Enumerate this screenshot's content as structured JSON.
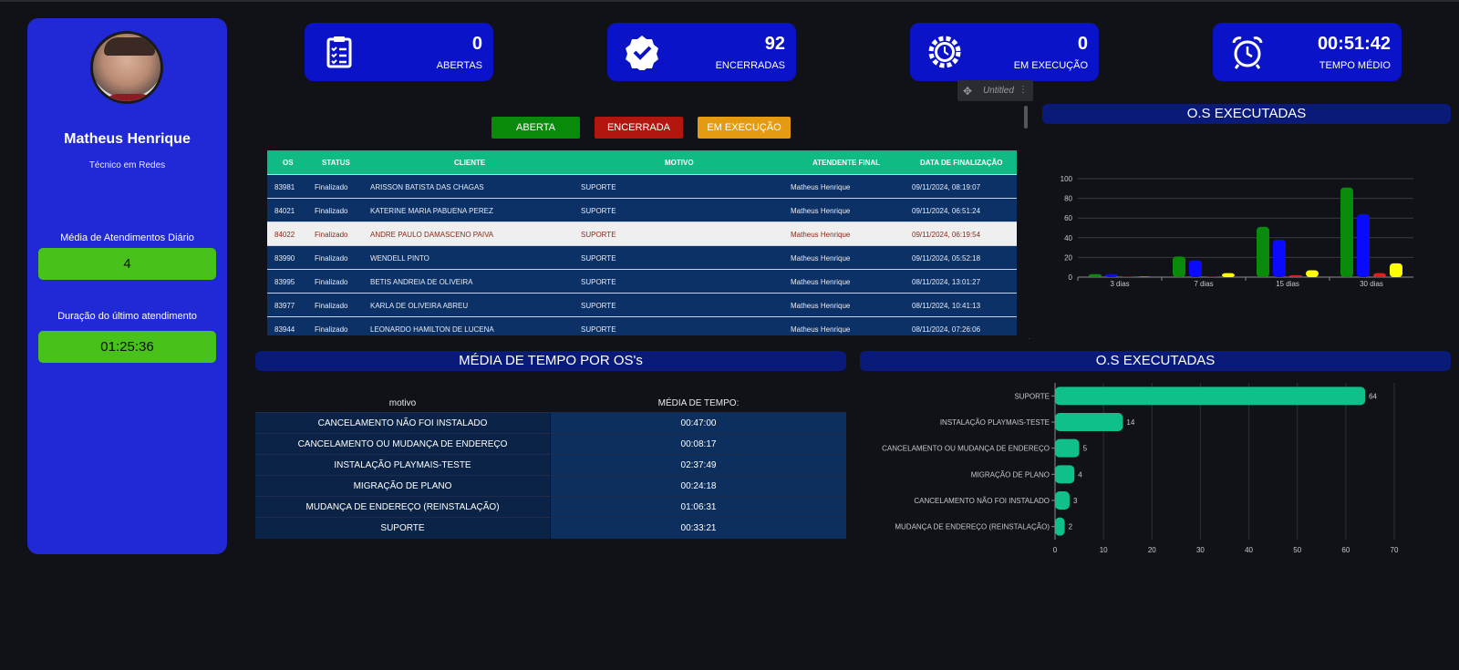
{
  "sidebar": {
    "name": "Matheus Henrique",
    "role": "Técnico em Redes",
    "daily_avg_label": "Média de Atendimentos Diário",
    "daily_avg_value": "4",
    "last_duration_label": "Duração do último atendimento",
    "last_duration_value": "01:25:36"
  },
  "kpis": [
    {
      "value": "0",
      "label": "ABERTAS",
      "icon": "clipboard-list-icon"
    },
    {
      "value": "92",
      "label": "ENCERRADAS",
      "icon": "badge-check-icon"
    },
    {
      "value": "0",
      "label": "EM EXECUÇÃO",
      "icon": "gear-clock-icon"
    },
    {
      "value": "00:51:42",
      "label": "TEMPO MÉDIO",
      "icon": "alarm-clock-icon"
    }
  ],
  "panel_tag": {
    "name": "Untitled",
    "move_icon": "move-icon",
    "menu_icon": "more-vertical-icon"
  },
  "filters": [
    {
      "label": "ABERTA",
      "color": "#0a8a0a"
    },
    {
      "label": "ENCERRADA",
      "color": "#b3160e"
    },
    {
      "label": "EM EXECUÇÃO",
      "color": "#e49b12"
    }
  ],
  "os_table": {
    "headers": [
      "OS",
      "STATUS",
      "CLIENTE",
      "MOTIVO",
      "ATENDENTE FINAL",
      "DATA DE FINALIZAÇÃO"
    ],
    "rows": [
      [
        "83981",
        "Finalizado",
        "ARISSON BATISTA DAS CHAGAS",
        "SUPORTE",
        "Matheus Henrique",
        "09/11/2024, 08:19:07"
      ],
      [
        "84021",
        "Finalizado",
        "KATERINE MARIA PABUENA PEREZ",
        "SUPORTE",
        "Matheus Henrique",
        "09/11/2024, 06:51:24"
      ],
      [
        "84022",
        "Finalizado",
        "ANDRE PAULO DAMASCENO PAIVA",
        "SUPORTE",
        "Matheus Henrique",
        "09/11/2024, 06:19:54"
      ],
      [
        "83990",
        "Finalizado",
        "WENDELL PINTO",
        "SUPORTE",
        "Matheus Henrique",
        "09/11/2024, 05:52:18"
      ],
      [
        "83995",
        "Finalizado",
        "BETIS ANDREIA DE OLIVEIRA",
        "SUPORTE",
        "Matheus Henrique",
        "08/11/2024, 13:01:27"
      ],
      [
        "83977",
        "Finalizado",
        "KARLA DE OLIVEIRA ABREU",
        "SUPORTE",
        "Matheus Henrique",
        "08/11/2024, 10:41:13"
      ],
      [
        "83944",
        "Finalizado",
        "LEONARDO HAMILTON DE LUCENA",
        "SUPORTE",
        "Matheus Henrique",
        "08/11/2024, 07:26:06"
      ]
    ],
    "selected_row": 2
  },
  "sections": {
    "top_chart_title": "O.S EXECUTADAS",
    "avg_title": "MÉDIA DE TEMPO POR OS's",
    "bottom_chart_title": "O.S EXECUTADAS"
  },
  "avg_table": {
    "headers": [
      "motivo",
      "MÉDIA DE TEMPO:"
    ],
    "rows": [
      [
        "CANCELAMENTO NÃO FOI INSTALADO",
        "00:47:00"
      ],
      [
        "CANCELAMENTO OU MUDANÇA DE ENDEREÇO",
        "00:08:17"
      ],
      [
        "INSTALAÇÃO PLAYMAIS-TESTE",
        "02:37:49"
      ],
      [
        "MIGRAÇÃO DE PLANO",
        "00:24:18"
      ],
      [
        "MUDANÇA DE ENDEREÇO (REINSTALAÇÃO)",
        "01:06:31"
      ],
      [
        "SUPORTE",
        "00:33:21"
      ]
    ]
  },
  "chart_data": [
    {
      "type": "bar",
      "categories": [
        "3 dias",
        "7 dias",
        "15 dias",
        "30 dias"
      ],
      "series": [
        {
          "color": "#0a8a0a",
          "values": [
            3,
            21,
            51,
            91
          ]
        },
        {
          "color": "#0a0aff",
          "values": [
            3,
            17,
            38,
            64
          ]
        },
        {
          "color": "#e11d1d",
          "values": [
            0,
            0,
            2,
            4
          ]
        },
        {
          "color": "#ffff00",
          "values": [
            0,
            4,
            7,
            14
          ]
        }
      ],
      "ylim": [
        0,
        100
      ],
      "yticks": [
        0,
        20,
        40,
        60,
        80,
        100
      ],
      "grid": true
    },
    {
      "type": "bar",
      "orientation": "horizontal",
      "categories": [
        "SUPORTE",
        "INSTALAÇÃO PLAYMAIS-TESTE",
        "CANCELAMENTO OU MUDANÇA DE ENDEREÇO",
        "MIGRAÇÃO DE PLANO",
        "CANCELAMENTO NÃO FOI INSTALADO",
        "MUDANÇA DE ENDEREÇO (REINSTALAÇÃO)"
      ],
      "values": [
        64,
        14,
        5,
        4,
        3,
        2
      ],
      "color": "#10c08a",
      "xlim": [
        0,
        70
      ],
      "xticks": [
        0,
        10,
        20,
        30,
        40,
        50,
        60,
        70
      ],
      "grid": true
    }
  ]
}
